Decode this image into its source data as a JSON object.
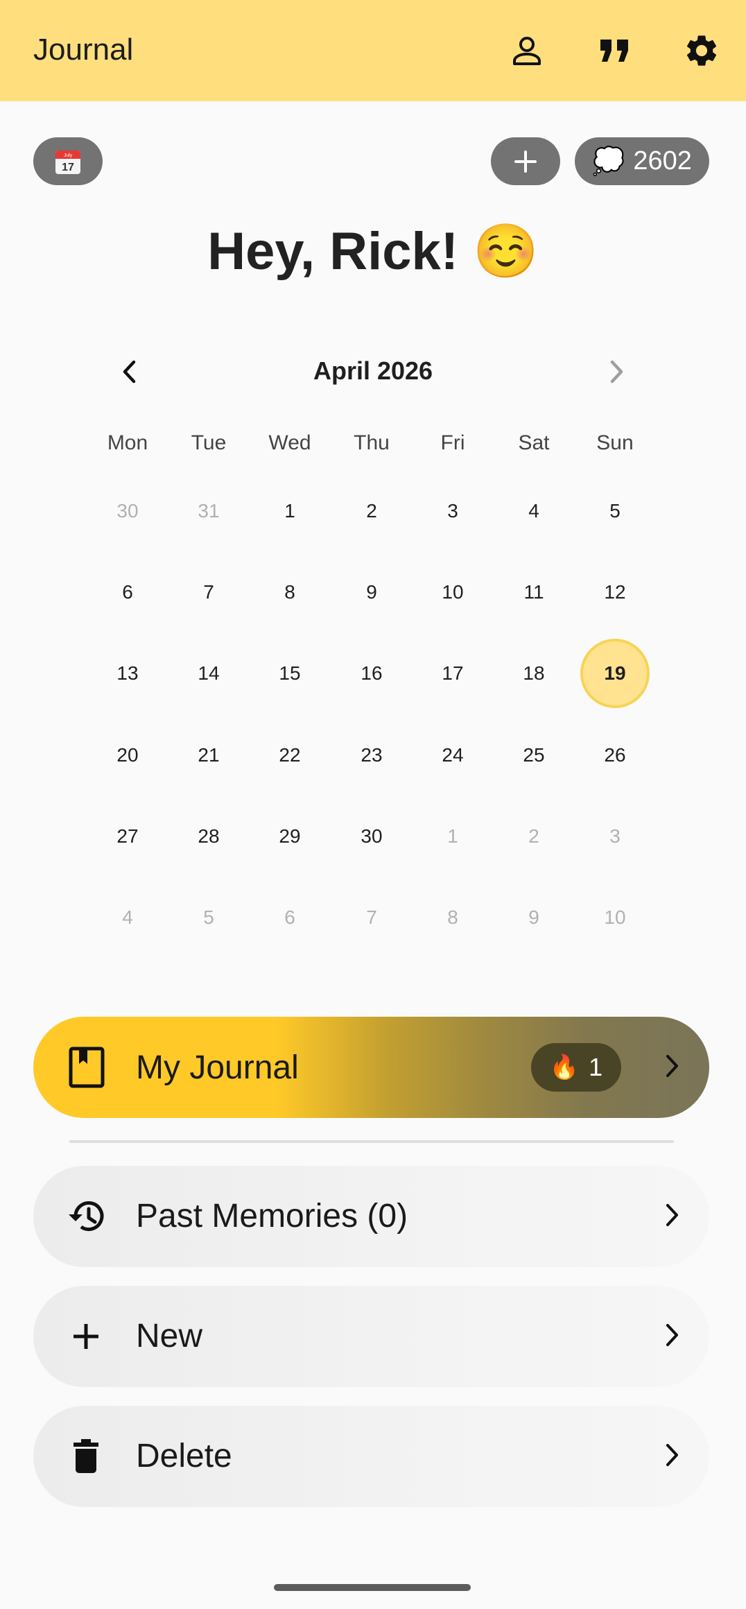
{
  "appbar": {
    "title": "Journal",
    "icons": [
      "person-icon",
      "quote-icon",
      "gear-icon"
    ]
  },
  "actions": {
    "calendar_icon_month": "July",
    "calendar_icon_day": "17",
    "add_icon": "plus-icon",
    "credits_icon": "thought-bubble-icon",
    "credits_count": "2602"
  },
  "greeting": "Hey, Rick! ☺️",
  "calendar": {
    "month_label": "April 2026",
    "weekdays": [
      "Mon",
      "Tue",
      "Wed",
      "Thu",
      "Fri",
      "Sat",
      "Sun"
    ],
    "weeks": [
      [
        {
          "d": "30",
          "m": true
        },
        {
          "d": "31",
          "m": true
        },
        {
          "d": "1"
        },
        {
          "d": "2"
        },
        {
          "d": "3"
        },
        {
          "d": "4"
        },
        {
          "d": "5"
        }
      ],
      [
        {
          "d": "6"
        },
        {
          "d": "7"
        },
        {
          "d": "8"
        },
        {
          "d": "9"
        },
        {
          "d": "10"
        },
        {
          "d": "11"
        },
        {
          "d": "12"
        }
      ],
      [
        {
          "d": "13"
        },
        {
          "d": "14"
        },
        {
          "d": "15"
        },
        {
          "d": "16"
        },
        {
          "d": "17"
        },
        {
          "d": "18"
        },
        {
          "d": "19",
          "today": true
        }
      ],
      [
        {
          "d": "20"
        },
        {
          "d": "21"
        },
        {
          "d": "22"
        },
        {
          "d": "23"
        },
        {
          "d": "24"
        },
        {
          "d": "25"
        },
        {
          "d": "26"
        }
      ],
      [
        {
          "d": "27"
        },
        {
          "d": "28"
        },
        {
          "d": "29"
        },
        {
          "d": "30"
        },
        {
          "d": "1",
          "m": true
        },
        {
          "d": "2",
          "m": true
        },
        {
          "d": "3",
          "m": true
        }
      ],
      [
        {
          "d": "4",
          "m": true
        },
        {
          "d": "5",
          "m": true
        },
        {
          "d": "6",
          "m": true
        },
        {
          "d": "7",
          "m": true
        },
        {
          "d": "8",
          "m": true
        },
        {
          "d": "9",
          "m": true
        },
        {
          "d": "10",
          "m": true
        }
      ]
    ]
  },
  "journal_button": {
    "label": "My Journal",
    "streak_icon": "🔥",
    "streak_count": "1"
  },
  "menu": {
    "past_memories": "Past Memories (0)",
    "new": "New",
    "delete": "Delete"
  },
  "colors": {
    "appbar": "#ffdf7d",
    "accent": "#ffc928",
    "today_fill": "#ffe391"
  }
}
